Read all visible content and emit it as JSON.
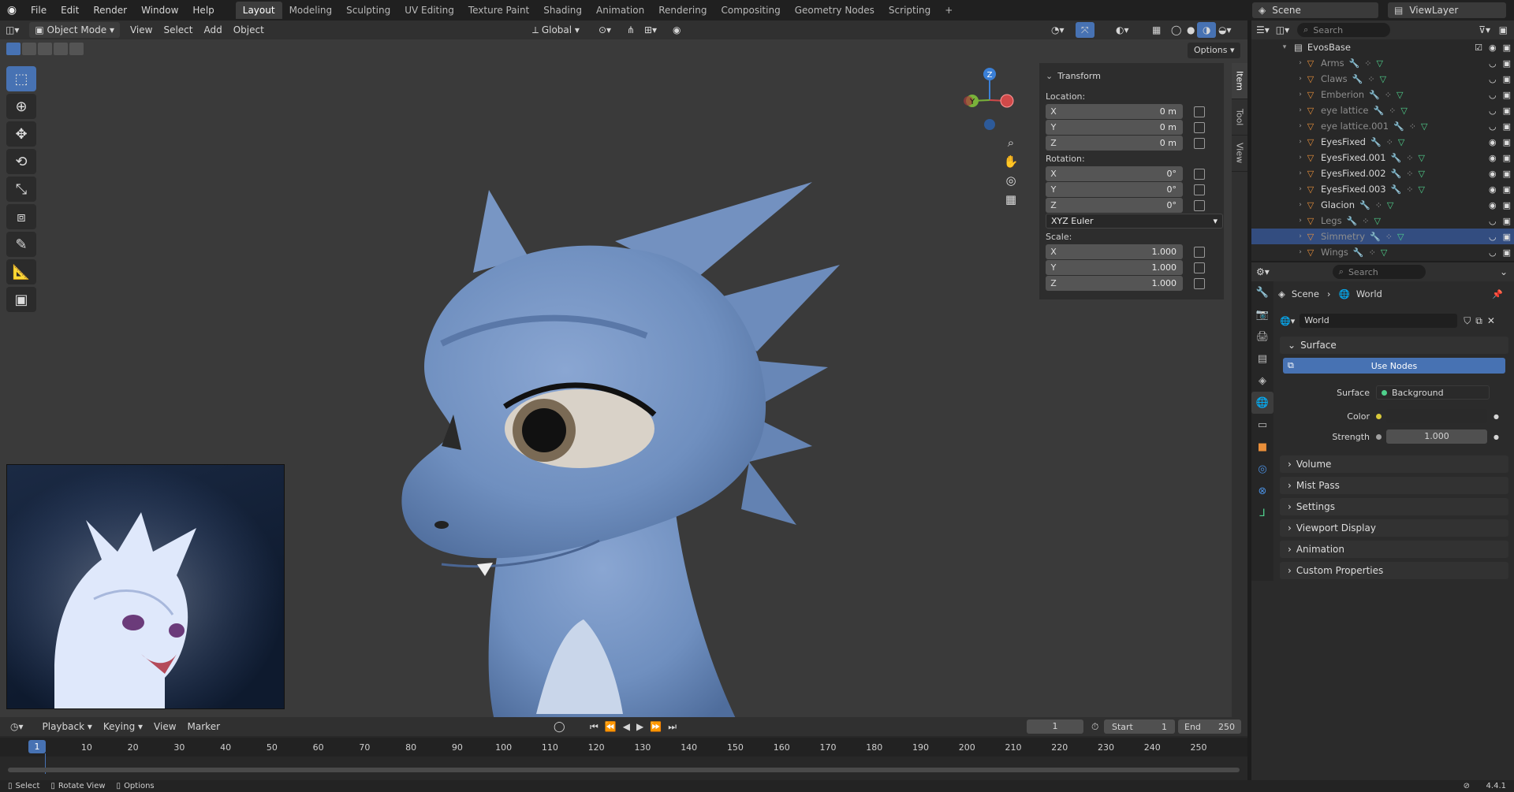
{
  "topbar": {
    "menus": [
      "File",
      "Edit",
      "Render",
      "Window",
      "Help"
    ],
    "workspaces": [
      "Layout",
      "Modeling",
      "Sculpting",
      "UV Editing",
      "Texture Paint",
      "Shading",
      "Animation",
      "Rendering",
      "Compositing",
      "Geometry Nodes",
      "Scripting"
    ],
    "active_workspace": "Layout",
    "add_tab": "+",
    "scene": "Scene",
    "view_layer": "ViewLayer"
  },
  "viewport_header": {
    "mode": "Object Mode",
    "menus": [
      "View",
      "Select",
      "Add",
      "Object"
    ],
    "orientation": "Global",
    "options": "Options"
  },
  "gizmo": {
    "z": "Z",
    "y": "Y"
  },
  "npanel": {
    "title": "Transform",
    "location_label": "Location:",
    "location": [
      {
        "axis": "X",
        "value": "0 m"
      },
      {
        "axis": "Y",
        "value": "0 m"
      },
      {
        "axis": "Z",
        "value": "0 m"
      }
    ],
    "rotation_label": "Rotation:",
    "rotation": [
      {
        "axis": "X",
        "value": "0°"
      },
      {
        "axis": "Y",
        "value": "0°"
      },
      {
        "axis": "Z",
        "value": "0°"
      }
    ],
    "rotation_mode": "XYZ Euler",
    "scale_label": "Scale:",
    "scale": [
      {
        "axis": "X",
        "value": "1.000"
      },
      {
        "axis": "Y",
        "value": "1.000"
      },
      {
        "axis": "Z",
        "value": "1.000"
      }
    ],
    "tabs": [
      "Item",
      "Tool",
      "View"
    ]
  },
  "outliner": {
    "search_placeholder": "Search",
    "collection": "EvosBase",
    "items": [
      {
        "name": "Arms",
        "dim": true
      },
      {
        "name": "Claws",
        "dim": true
      },
      {
        "name": "Emberion",
        "dim": true
      },
      {
        "name": "eye lattice",
        "dim": true
      },
      {
        "name": "eye lattice.001",
        "dim": true
      },
      {
        "name": "EyesFixed",
        "dim": false
      },
      {
        "name": "EyesFixed.001",
        "dim": false
      },
      {
        "name": "EyesFixed.002",
        "dim": false
      },
      {
        "name": "EyesFixed.003",
        "dim": false
      },
      {
        "name": "Glacion",
        "dim": false
      },
      {
        "name": "Legs",
        "dim": true
      },
      {
        "name": "Simmetry",
        "dim": true,
        "selected": true
      },
      {
        "name": "Wings",
        "dim": true
      }
    ]
  },
  "properties": {
    "search_placeholder": "Search",
    "breadcrumb": [
      "Scene",
      "World"
    ],
    "world_name": "World",
    "surface_panel": "Surface",
    "use_nodes": "Use Nodes",
    "surface_label": "Surface",
    "surface_value": "Background",
    "color_label": "Color",
    "strength_label": "Strength",
    "strength_value": "1.000",
    "panels": [
      "Volume",
      "Mist Pass",
      "Settings",
      "Viewport Display",
      "Animation",
      "Custom Properties"
    ]
  },
  "timeline": {
    "menus": [
      "Playback",
      "Keying",
      "View",
      "Marker"
    ],
    "current_frame": "1",
    "start_label": "Start",
    "start": "1",
    "end_label": "End",
    "end": "250",
    "ticks": [
      "10",
      "20",
      "30",
      "40",
      "50",
      "60",
      "70",
      "80",
      "90",
      "100",
      "110",
      "120",
      "130",
      "140",
      "150",
      "160",
      "170",
      "180",
      "190",
      "200",
      "210",
      "220",
      "230",
      "240",
      "250"
    ],
    "playhead": "1"
  },
  "statusbar": {
    "items": [
      "Select",
      "Rotate View",
      "Options"
    ],
    "version": "4.4.1"
  },
  "colors": {
    "accent": "#4772b3",
    "viewport_bg": "#3a3a3a",
    "creature": "#6f8fbf"
  }
}
